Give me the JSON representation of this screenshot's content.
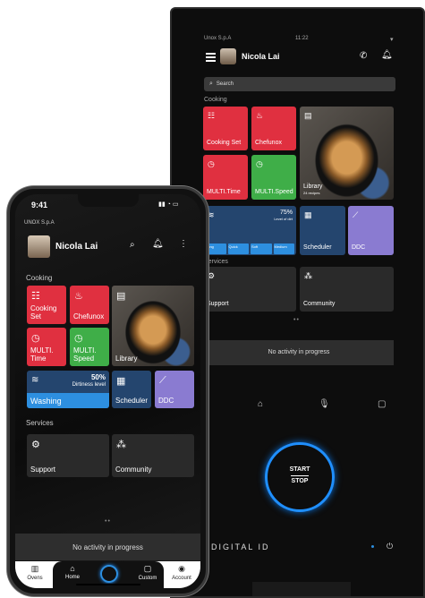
{
  "tablet": {
    "company": "Unox S.p.A",
    "clock": "11:22",
    "user_name": "Nicola Lai",
    "search_placeholder": "Search",
    "cooking_heading": "Cooking",
    "tiles": {
      "cooking_set": "Cooking Set",
      "chefunox": "Chefunox",
      "library": "Library",
      "library_sub": "24 recipes",
      "multi_time": "MULTI.Time",
      "multi_speed": "MULTI.Speed",
      "dirtiness_value": "75%",
      "dirtiness_label": "Level of dirt",
      "washing_modes": [
        "Long",
        "Quick",
        "Soft",
        "Medium"
      ],
      "scheduler": "Scheduler",
      "ddc": "DDC"
    },
    "services_heading": "Services",
    "support": "Support",
    "community": "Community",
    "no_activity": "No activity in progress",
    "start": "START",
    "stop": "STOP",
    "brand": "DIGITAL ID"
  },
  "phone": {
    "time": "9:41",
    "company": "UNOX S.p.A",
    "user_name": "Nicola Lai",
    "cooking_heading": "Cooking",
    "tiles": {
      "cooking_set": "Cooking\nSet",
      "chefunox": "Chefunox",
      "library": "Library",
      "multi_time": "MULTI.\nTime",
      "multi_speed": "MULTI.\nSpeed",
      "dirtiness_value": "50%",
      "dirtiness_label": "Dirtiness level",
      "washing": "Washing",
      "scheduler": "Scheduler",
      "ddc": "DDC"
    },
    "services_heading": "Services",
    "support": "Support",
    "community": "Community",
    "no_activity": "No activity in progress",
    "nav": {
      "ovens": "Ovens",
      "home": "Home",
      "custom": "Custom",
      "account": "Account"
    }
  },
  "colors": {
    "red": "#e03040",
    "green": "#3fae48",
    "blue": "#2d8fe0",
    "purple": "#8a7bd1",
    "navy": "#24456e"
  }
}
